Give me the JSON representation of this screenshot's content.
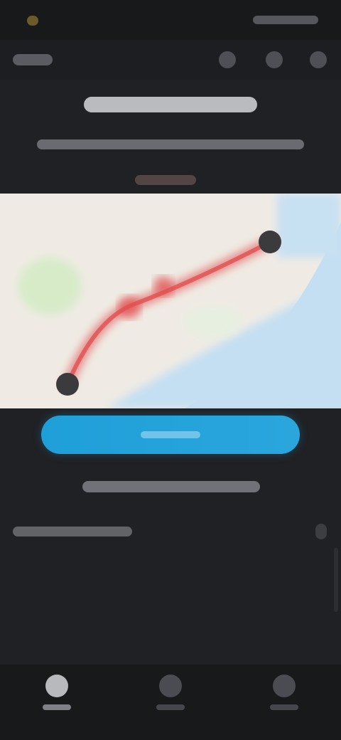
{
  "colors": {
    "background": "#202124",
    "status_bar": "#18191b",
    "accent_button": "#1f9fd8",
    "route_line": "#e05050",
    "map_land": "#efebe4",
    "map_water": "#c4dff2",
    "map_park": "#d7ebc9",
    "pin": "#3b3b3d"
  },
  "icons": {
    "app_bar_1": "filter-icon",
    "app_bar_2": "share-icon",
    "app_bar_3": "more-icon",
    "nav_1": "home-icon",
    "nav_2": "explore-icon",
    "nav_3": "profile-icon",
    "section": "chevron-right-icon",
    "map_start": "start-pin-icon",
    "map_end": "end-pin-icon"
  },
  "bottom_nav": {
    "active_index": 0
  }
}
